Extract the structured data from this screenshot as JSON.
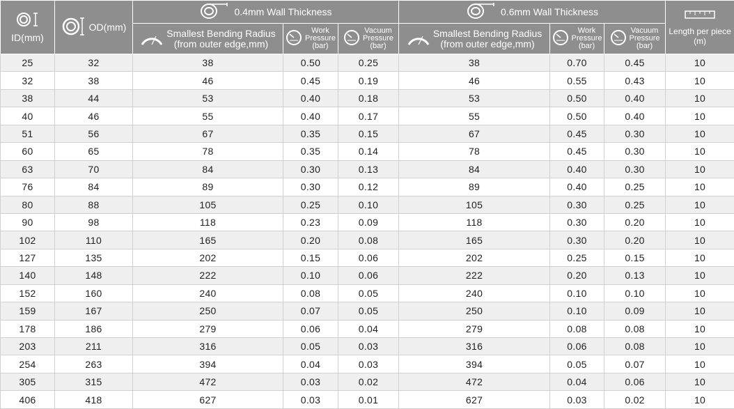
{
  "header": {
    "id_label": "ID(mm)",
    "od_label": "OD(mm)",
    "wall_04": "0.4mm Wall Thickness",
    "wall_06": "0.6mm Wall Thickness",
    "bend_radius_line1": "Smallest Bending Radius",
    "bend_radius_line2": "(from outer edge,mm)",
    "work_line1": "Work",
    "work_line2": "Pressure",
    "work_line3": "(bar)",
    "vac_line1": "Vacuum",
    "vac_line2": "Pressure",
    "vac_line3": "(bar)",
    "length_line1": "Length per piece",
    "length_line2": "(m)"
  },
  "rows": [
    [
      "25",
      "32",
      "38",
      "0.50",
      "0.25",
      "38",
      "0.70",
      "0.45",
      "10"
    ],
    [
      "32",
      "38",
      "46",
      "0.45",
      "0.19",
      "46",
      "0.55",
      "0.43",
      "10"
    ],
    [
      "38",
      "44",
      "53",
      "0.40",
      "0.18",
      "53",
      "0.50",
      "0.40",
      "10"
    ],
    [
      "40",
      "46",
      "55",
      "0.40",
      "0.17",
      "55",
      "0.50",
      "0.40",
      "10"
    ],
    [
      "51",
      "56",
      "67",
      "0.35",
      "0.15",
      "67",
      "0.45",
      "0.30",
      "10"
    ],
    [
      "60",
      "65",
      "78",
      "0.35",
      "0.14",
      "78",
      "0.45",
      "0.30",
      "10"
    ],
    [
      "63",
      "70",
      "84",
      "0.30",
      "0.13",
      "84",
      "0.40",
      "0.30",
      "10"
    ],
    [
      "76",
      "84",
      "89",
      "0.30",
      "0.12",
      "89",
      "0.40",
      "0.25",
      "10"
    ],
    [
      "80",
      "88",
      "105",
      "0.25",
      "0.10",
      "105",
      "0.30",
      "0.25",
      "10"
    ],
    [
      "90",
      "98",
      "118",
      "0.23",
      "0.09",
      "118",
      "0.30",
      "0.20",
      "10"
    ],
    [
      "102",
      "110",
      "165",
      "0.20",
      "0.08",
      "165",
      "0.30",
      "0.20",
      "10"
    ],
    [
      "127",
      "135",
      "202",
      "0.15",
      "0.06",
      "202",
      "0.25",
      "0.15",
      "10"
    ],
    [
      "140",
      "148",
      "222",
      "0.10",
      "0.06",
      "222",
      "0.20",
      "0.13",
      "10"
    ],
    [
      "152",
      "160",
      "240",
      "0.08",
      "0.05",
      "240",
      "0.10",
      "0.10",
      "10"
    ],
    [
      "159",
      "167",
      "250",
      "0.07",
      "0.05",
      "250",
      "0.10",
      "0.09",
      "10"
    ],
    [
      "178",
      "186",
      "279",
      "0.06",
      "0.04",
      "279",
      "0.08",
      "0.08",
      "10"
    ],
    [
      "203",
      "211",
      "316",
      "0.05",
      "0.03",
      "316",
      "0.06",
      "0.08",
      "10"
    ],
    [
      "254",
      "263",
      "394",
      "0.04",
      "0.03",
      "394",
      "0.05",
      "0.07",
      "10"
    ],
    [
      "305",
      "315",
      "472",
      "0.03",
      "0.02",
      "472",
      "0.04",
      "0.06",
      "10"
    ],
    [
      "406",
      "418",
      "627",
      "0.03",
      "0.01",
      "627",
      "0.03",
      "0.02",
      "10"
    ]
  ],
  "icons": {
    "id": "inner-diameter-icon",
    "od": "outer-diameter-icon",
    "coil": "coiled-hose-icon",
    "bend": "bending-radius-icon",
    "gauge": "pressure-gauge-icon",
    "ruler": "ruler-icon"
  },
  "colors": {
    "header_bg": "#8e8e8e",
    "row_odd": "#efefef",
    "row_even": "#ffffff",
    "text": "#222222"
  }
}
